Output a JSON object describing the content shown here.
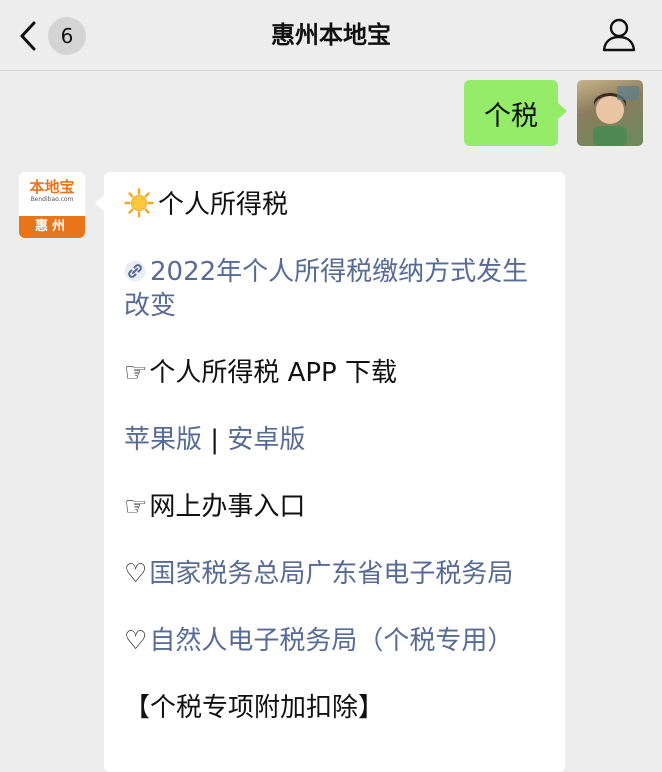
{
  "header": {
    "title": "惠州本地宝",
    "unread_count": "6"
  },
  "chat": {
    "outgoing": {
      "text": "个税"
    },
    "bot_avatar": {
      "logo_text": "本地宝",
      "logo_url": "Bendibao.com",
      "city": "惠州"
    },
    "incoming": {
      "heading": "个人所得税",
      "news_link": "2022年个人所得税缴纳方式发生改变",
      "app_heading": "个人所得税 APP 下载",
      "apple_link": "苹果版",
      "separator": "|",
      "android_link": "安卓版",
      "online_heading": "网上办事入口",
      "guangdong_link": "国家税务总局广东省电子税务局",
      "natural_link": "自然人电子税务局（个税专用）",
      "deduction_heading": "【个税专项附加扣除】"
    }
  },
  "icons": {
    "back": "chevron-left-icon",
    "profile": "person-icon",
    "sun": "sun-icon",
    "chain": "link-icon",
    "pointing_hand": "☞",
    "heart": "♡"
  },
  "colors": {
    "background": "#ededed",
    "bubble_out": "#95ec69",
    "bubble_in": "#ffffff",
    "link": "#576b95",
    "brand_orange": "#e8751a"
  }
}
